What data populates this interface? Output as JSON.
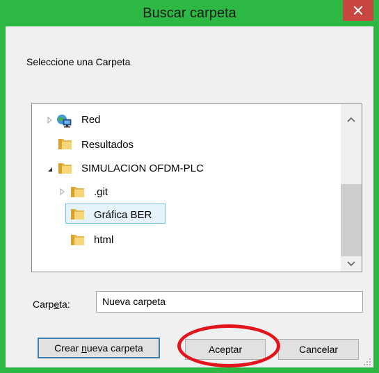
{
  "window": {
    "title": "Buscar carpeta",
    "accent_color": "#2cb843",
    "close_icon": "close-icon"
  },
  "dialog": {
    "prompt": "Seleccione una Carpeta",
    "tree": {
      "items": [
        {
          "label": "Red",
          "icon": "network-icon",
          "expander": "collapsed"
        },
        {
          "label": "Resultados",
          "icon": "folder-icon",
          "expander": "none"
        },
        {
          "label": "SIMULACION OFDM-PLC",
          "icon": "folder-icon",
          "expander": "expanded"
        },
        {
          "label": ".git",
          "icon": "folder-icon",
          "expander": "collapsed"
        },
        {
          "label": "Gráfica BER",
          "icon": "folder-icon",
          "expander": "none",
          "selected": true
        },
        {
          "label": "html",
          "icon": "folder-icon",
          "expander": "none"
        }
      ]
    },
    "folder_field": {
      "label_pre": "Carp",
      "label_accel": "e",
      "label_post": "ta:",
      "value": "Nueva carpeta"
    },
    "buttons": {
      "new_folder_pre": "Crear ",
      "new_folder_accel": "n",
      "new_folder_post": "ueva carpeta",
      "ok": "Aceptar",
      "cancel": "Cancelar"
    },
    "annotation_color": "#e3151c"
  }
}
